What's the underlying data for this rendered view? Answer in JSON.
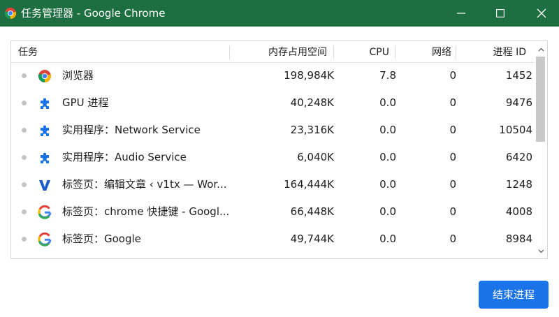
{
  "window": {
    "title": "任务管理器 - Google Chrome",
    "titlebar_color": "#1d6e40"
  },
  "table": {
    "columns": {
      "task": "任务",
      "memory": "内存占用空间",
      "cpu": "CPU",
      "network": "网络",
      "pid": "进程 ID"
    },
    "rows": [
      {
        "icon": "chrome-icon",
        "name": "浏览器",
        "memory": "198,984K",
        "cpu": "7.8",
        "network": "0",
        "pid": "1452"
      },
      {
        "icon": "puzzle-piece-icon",
        "name": "GPU 进程",
        "memory": "40,248K",
        "cpu": "0.0",
        "network": "0",
        "pid": "9476"
      },
      {
        "icon": "puzzle-piece-icon",
        "name": "实用程序：Network Service",
        "memory": "23,316K",
        "cpu": "0.0",
        "network": "0",
        "pid": "10504"
      },
      {
        "icon": "puzzle-piece-icon",
        "name": "实用程序：Audio Service",
        "memory": "6,040K",
        "cpu": "0.0",
        "network": "0",
        "pid": "6420"
      },
      {
        "icon": "v-logo-icon",
        "name": "标签页：编辑文章 ‹ v1tx — Wor...",
        "memory": "164,444K",
        "cpu": "0.0",
        "network": "0",
        "pid": "1248"
      },
      {
        "icon": "google-g-icon",
        "name": "标签页：chrome 快捷键 - Googl...",
        "memory": "66,448K",
        "cpu": "0.0",
        "network": "0",
        "pid": "4008"
      },
      {
        "icon": "google-g-icon",
        "name": "标签页：Google",
        "memory": "49,744K",
        "cpu": "0.0",
        "network": "0",
        "pid": "8984"
      }
    ]
  },
  "actions": {
    "end_process_label": "结束进程",
    "accent_color": "#1a73e8"
  }
}
